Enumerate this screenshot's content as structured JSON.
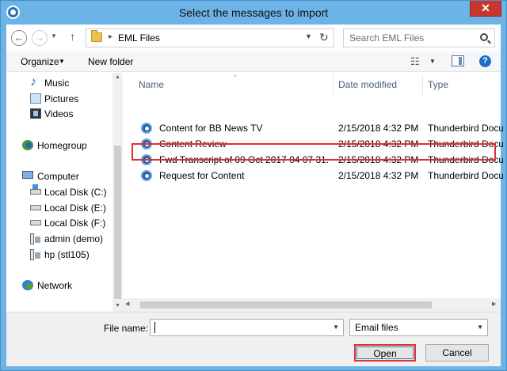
{
  "window": {
    "title": "Select the messages to import",
    "close_glyph": "✕"
  },
  "address": {
    "path": "EML Files",
    "search_placeholder": "Search EML Files"
  },
  "toolbar": {
    "organize_label": "Organize",
    "new_folder_label": "New folder"
  },
  "nav_pane": {
    "items": [
      {
        "label": "Music",
        "icon": "music-icon"
      },
      {
        "label": "Pictures",
        "icon": "pictures-icon"
      },
      {
        "label": "Videos",
        "icon": "videos-icon"
      },
      {
        "label": "Homegroup",
        "icon": "homegroup-icon"
      },
      {
        "label": "Computer",
        "icon": "computer-icon"
      },
      {
        "label": "Local Disk (C:)",
        "icon": "disk-icon"
      },
      {
        "label": "Local Disk (E:)",
        "icon": "disk-icon"
      },
      {
        "label": "Local Disk (F:)",
        "icon": "disk-icon"
      },
      {
        "label": "admin (demo)",
        "icon": "network-drive-icon"
      },
      {
        "label": "hp (stl105)",
        "icon": "network-drive-icon"
      },
      {
        "label": "Network",
        "icon": "network-icon"
      }
    ]
  },
  "file_list": {
    "columns": [
      "Name",
      "Date modified",
      "Type"
    ],
    "rows": [
      {
        "name": "Content for BB News TV",
        "date": "2/15/2018 4:32 PM",
        "type": "Thunderbird Docu..."
      },
      {
        "name": "Content Review",
        "date": "2/15/2018 4:32 PM",
        "type": "Thunderbird Docu..."
      },
      {
        "name": "Fwd Transcript of 09 Oct 2017 04 07 31. O...",
        "date": "2/15/2018 4:32 PM",
        "type": "Thunderbird Docu..."
      },
      {
        "name": "Request for Content",
        "date": "2/15/2018 4:32 PM",
        "type": "Thunderbird Docu..."
      }
    ],
    "highlighted_row": "Request for Content"
  },
  "bottom": {
    "file_name_label": "File name:",
    "file_name_value": "",
    "file_type_value": "Email files",
    "open_label": "Open",
    "cancel_label": "Cancel"
  },
  "colors": {
    "title_bar": "#6cb4e8",
    "close_button": "#c7372f",
    "highlight": "#e03030",
    "column_header": "#4c607a"
  }
}
